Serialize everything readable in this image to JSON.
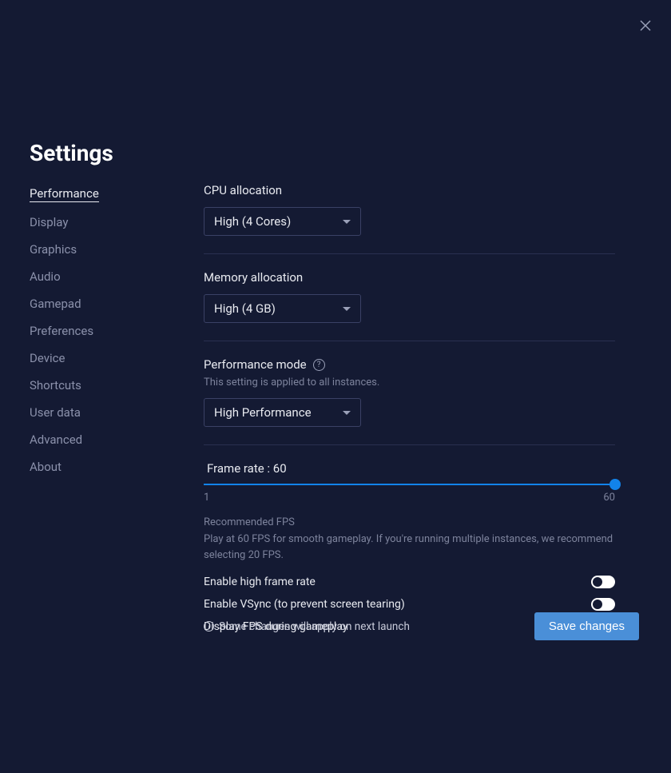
{
  "title": "Settings",
  "close_icon": "close",
  "sidebar": {
    "items": [
      {
        "label": "Performance",
        "active": true
      },
      {
        "label": "Display",
        "active": false
      },
      {
        "label": "Graphics",
        "active": false
      },
      {
        "label": "Audio",
        "active": false
      },
      {
        "label": "Gamepad",
        "active": false
      },
      {
        "label": "Preferences",
        "active": false
      },
      {
        "label": "Device",
        "active": false
      },
      {
        "label": "Shortcuts",
        "active": false
      },
      {
        "label": "User data",
        "active": false
      },
      {
        "label": "Advanced",
        "active": false
      },
      {
        "label": "About",
        "active": false
      }
    ]
  },
  "cpu": {
    "label": "CPU allocation",
    "value": "High (4 Cores)"
  },
  "memory": {
    "label": "Memory allocation",
    "value": "High (4 GB)"
  },
  "perfmode": {
    "label": "Performance mode",
    "sublabel": "This setting is applied to all instances.",
    "value": "High Performance"
  },
  "framerate": {
    "label_prefix": "Frame rate : ",
    "value": "60",
    "min": "1",
    "max": "60",
    "rec_head": "Recommended FPS",
    "rec_body": "Play at 60 FPS for smooth gameplay. If you're running multiple instances, we recommend selecting 20 FPS."
  },
  "toggles": {
    "high_fps": {
      "label": "Enable high frame rate",
      "on": false
    },
    "vsync": {
      "label": "Enable VSync (to prevent screen tearing)",
      "on": false
    },
    "display_fps": {
      "label": "Display FPS during gameplay",
      "on": true
    }
  },
  "footer": {
    "note": "Some changes will apply on next launch",
    "save": "Save changes"
  },
  "colors": {
    "accent": "#1283ea",
    "bg": "#141a33"
  }
}
